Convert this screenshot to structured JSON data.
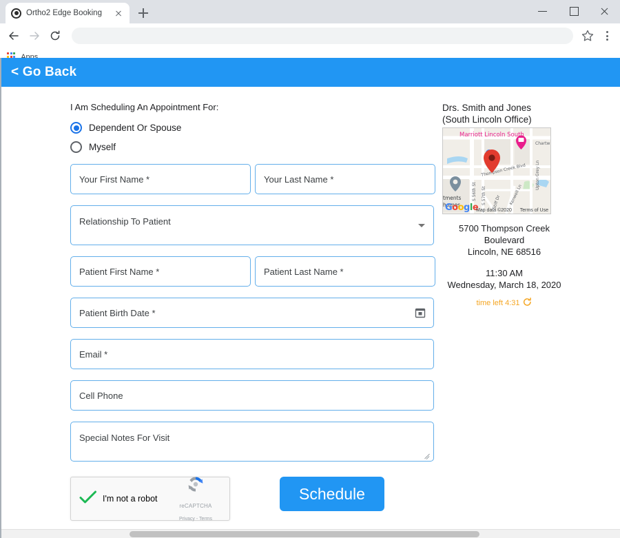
{
  "browser": {
    "tab": {
      "title": "Ortho2 Edge Booking",
      "favicon": "ortho2-favicon",
      "close_icon": "close-icon"
    },
    "new_tab_icon": "plus-icon",
    "window_controls": {
      "minimize": "minimize-icon",
      "maximize": "maximize-icon",
      "close": "close-icon"
    },
    "nav": {
      "back_icon": "back-arrow-icon",
      "forward_icon": "forward-arrow-icon",
      "reload_icon": "reload-icon"
    },
    "omnibox": {
      "value": "",
      "placeholder": ""
    },
    "star_icon": "bookmark-star-icon",
    "menu_icon": "three-dot-menu-icon",
    "bookmarks": {
      "apps_icon": "apps-grid-icon",
      "apps_label": "Apps"
    }
  },
  "appbar": {
    "back_label": "< Go Back"
  },
  "form": {
    "scheduling_for_label": "I Am Scheduling An Appointment For:",
    "radios": [
      {
        "label": "Dependent Or Spouse",
        "checked": true
      },
      {
        "label": "Myself",
        "checked": false
      }
    ],
    "fields": {
      "your_first_name": "Your First Name *",
      "your_last_name": "Your Last Name *",
      "relationship": "Relationship To Patient",
      "patient_first_name": "Patient First Name *",
      "patient_last_name": "Patient Last Name *",
      "patient_birth_date": "Patient Birth Date *",
      "email": "Email *",
      "cell_phone": "Cell Phone",
      "special_notes": "Special Notes For Visit"
    },
    "icons": {
      "dropdown": "chevron-down-icon",
      "calendar": "calendar-icon",
      "resize": "resize-grip-icon"
    },
    "recaptcha": {
      "checkbox_label": "I'm not a robot",
      "checked": true,
      "brand": "reCAPTCHA",
      "terms": "Privacy - Terms",
      "check_icon": "green-check-icon",
      "logo_icon": "recaptcha-logo-icon"
    },
    "submit_label": "Schedule"
  },
  "appointment": {
    "office_name": "Drs. Smith and Jones (South Lincoln Office)",
    "map": {
      "labels": {
        "hotel": "Marriott Lincoln South",
        "street_main": "Thompson Creek Blvd",
        "street_56": "S 56th St",
        "street_57": "S 57th St",
        "street_kenwell": "Kenwell Ln",
        "street_upton": "Upton Grey Ln",
        "street_stiff": "Stiff Dr",
        "partial_right": "Chartw",
        "partial_left_1": "tments",
        "partial_left_2": "homes"
      },
      "logo": "Google",
      "attribution": "Map data ©2020",
      "terms": "Terms of Use",
      "pin_icon": "map-pin-icon"
    },
    "address_line1": "5700 Thompson Creek",
    "address_line2": "Boulevard",
    "address_line3": "Lincoln, NE 68516",
    "time": "11:30 AM",
    "date": "Wednesday, March 18, 2020",
    "time_left": "time left 4:31",
    "refresh_icon": "refresh-icon"
  },
  "colors": {
    "accent": "#2196f3",
    "field_border": "#62aeea",
    "radio_selected": "#1a73e8",
    "time_left": "#f5a623"
  }
}
